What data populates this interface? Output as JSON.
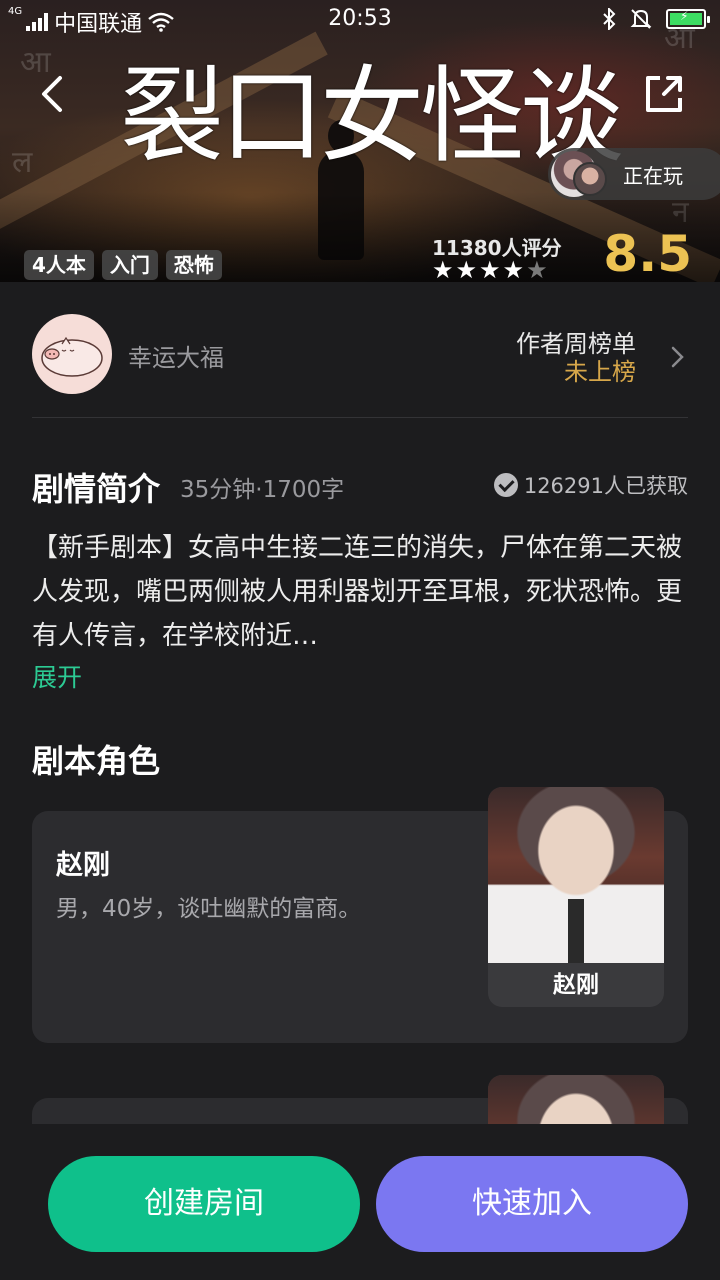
{
  "status_bar": {
    "network": "4G",
    "carrier": "中国联通",
    "time": "20:53",
    "icons": [
      "signal-icon",
      "wifi-icon",
      "bluetooth-icon",
      "mute-bell-icon",
      "battery-charging-icon"
    ],
    "battery_color": "#3ddc62"
  },
  "hero": {
    "title": "裂口女怪谈",
    "playing_label": "正在玩",
    "tags": [
      "4人本",
      "入门",
      "恐怖"
    ],
    "rating_count": "11380人评分",
    "stars_filled": 4,
    "stars_total": 5,
    "score": "8.5",
    "score_color": "#ecc253"
  },
  "author": {
    "name": "幸运大福",
    "rank_label": "作者周榜单",
    "rank_value": "未上榜",
    "rank_value_color": "#d7a74a"
  },
  "synopsis": {
    "heading": "剧情简介",
    "meta": "35分钟·1700字",
    "obtained": "126291人已获取",
    "body": "【新手剧本】女高中生接二连三的消失，尸体在第二天被人发现，嘴巴两侧被人用利器划开至耳根，死状恐怖。更有人传言，在学校附近…",
    "expand_label": "展开",
    "expand_color": "#2ccb94"
  },
  "roles": {
    "heading": "剧本角色",
    "items": [
      {
        "name": "赵刚",
        "desc": "男，40岁，谈吐幽默的富商。",
        "portrait_label": "赵刚"
      }
    ]
  },
  "actions": {
    "create_label": "创建房间",
    "create_color": "#0fc08b",
    "join_label": "快速加入",
    "join_color": "#7b77f1"
  }
}
